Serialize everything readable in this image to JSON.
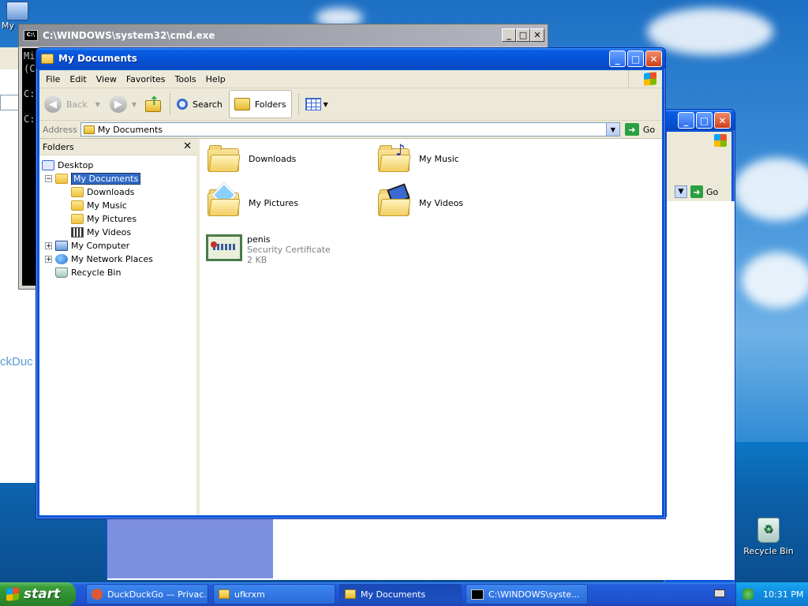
{
  "desktop": {
    "partial_icon_label": "My",
    "recycle_bin_label": "Recycle Bin"
  },
  "cmd": {
    "title": "C:\\WINDOWS\\system32\\cmd.exe",
    "lines": [
      "Mi",
      "(C",
      "",
      "C:",
      "",
      "C:"
    ]
  },
  "background_browser": {
    "partial_text": "ckDuc",
    "go_label": "Go"
  },
  "explorer": {
    "title": "My Documents",
    "menu": [
      "File",
      "Edit",
      "View",
      "Favorites",
      "Tools",
      "Help"
    ],
    "toolbar": {
      "back_label": "Back",
      "search_label": "Search",
      "folders_label": "Folders"
    },
    "address": {
      "label": "Address",
      "value": "My Documents",
      "go_label": "Go"
    },
    "folders_pane": {
      "title": "Folders",
      "tree": [
        {
          "label": "Desktop"
        },
        {
          "label": "My Documents"
        },
        {
          "label": "Downloads"
        },
        {
          "label": "My Music"
        },
        {
          "label": "My Pictures"
        },
        {
          "label": "My Videos"
        },
        {
          "label": "My Computer"
        },
        {
          "label": "My Network Places"
        },
        {
          "label": "Recycle Bin"
        }
      ]
    },
    "items": [
      {
        "name": "Downloads"
      },
      {
        "name": "My Music"
      },
      {
        "name": "My Pictures"
      },
      {
        "name": "My Videos"
      },
      {
        "name": "penis",
        "type": "Security Certificate",
        "size": "2 KB"
      }
    ]
  },
  "taskbar": {
    "start_label": "start",
    "tasks": [
      {
        "label": "DuckDuckGo — Privac..."
      },
      {
        "label": "ufkrxm"
      },
      {
        "label": "My Documents"
      },
      {
        "label": "C:\\WINDOWS\\syste..."
      }
    ],
    "clock": "10:31 PM"
  }
}
